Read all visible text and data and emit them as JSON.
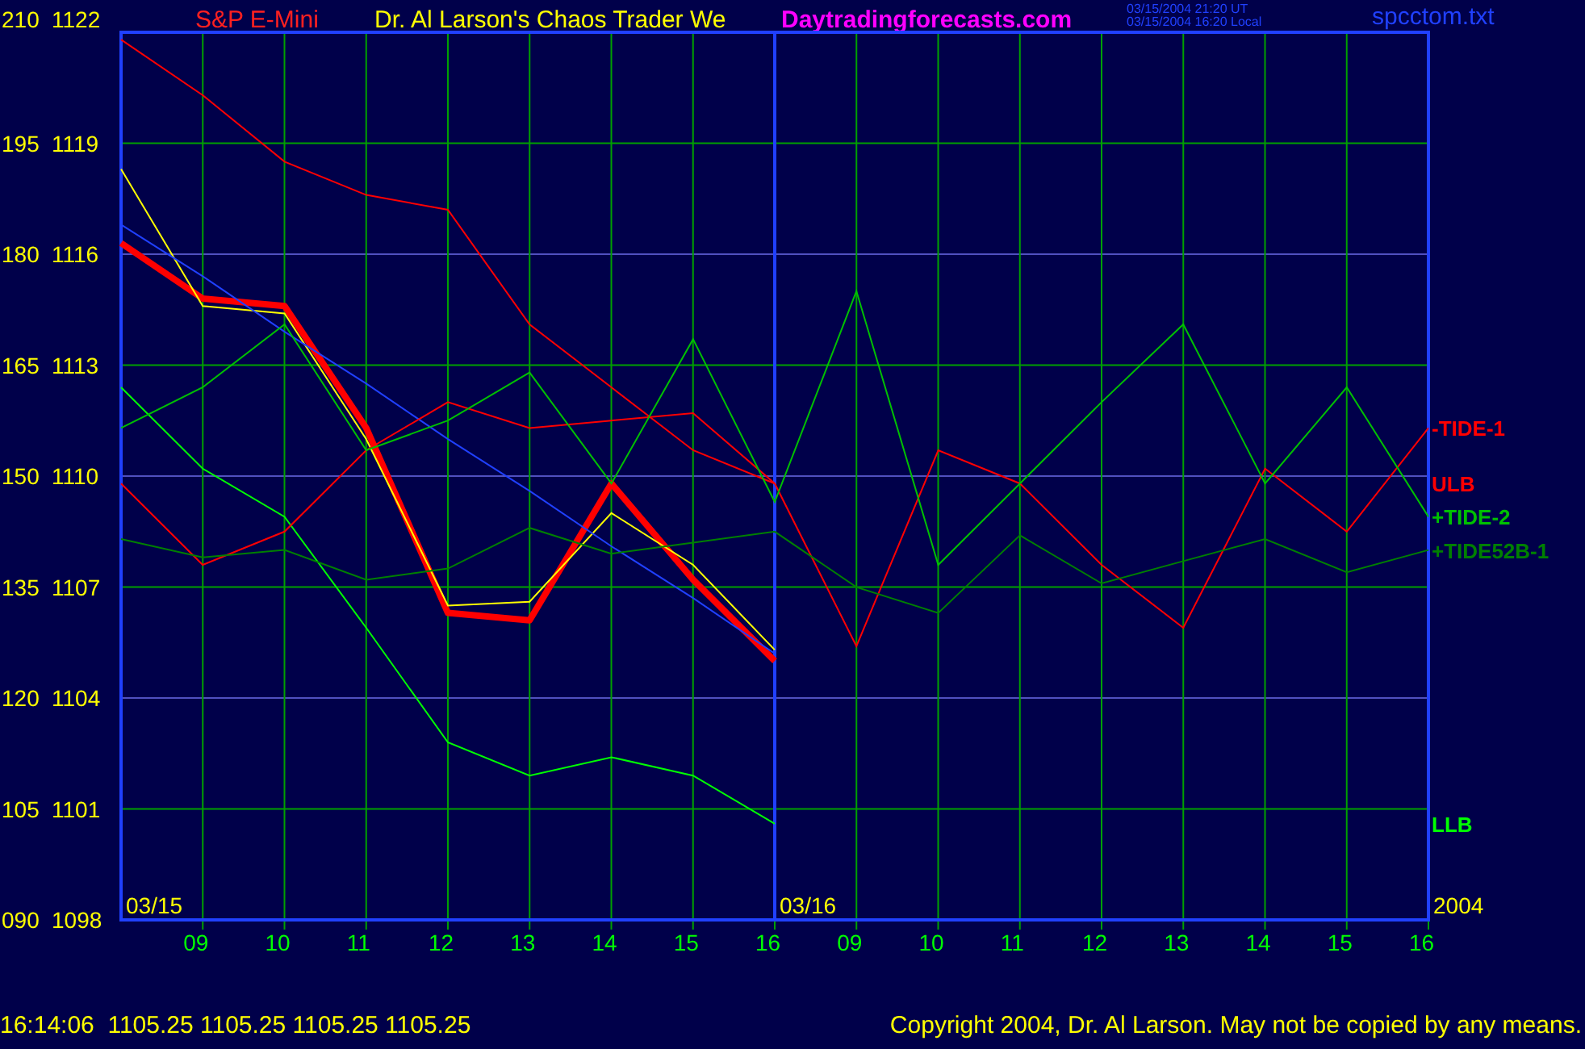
{
  "header": {
    "instrument": "S&P E-Mini",
    "title": "Dr. Al Larson's Chaos Trader We",
    "site": "Daytradingforecasts.com",
    "timestamps": [
      "03/15/2004 21:20 UT",
      "03/15/2004 16:20 Local"
    ],
    "file": "spcctom.txt"
  },
  "chart": {
    "chart_data": {
      "type": "line",
      "categories": [
        null,
        "09",
        "10",
        "11",
        "12",
        "13",
        "14",
        "15",
        "16",
        "09",
        "10",
        "11",
        "12",
        "13",
        "14",
        "15",
        "16"
      ],
      "ylim": [
        1098,
        1122
      ],
      "grid": true,
      "yticks": [
        1122,
        1119,
        1116,
        1113,
        1110,
        1107,
        1104,
        1101,
        1098
      ],
      "series": [
        {
          "color": "#ff0000",
          "values": [
            1116.3,
            1114.8,
            1114.6,
            1111.3,
            1106.3,
            1106.1,
            1109.8,
            1107.2,
            1105.0,
            null,
            null,
            null,
            null,
            null,
            null,
            null,
            null
          ]
        },
        {
          "color": "#ffff00",
          "values": [
            1118.3,
            1114.6,
            1114.4,
            1111.0,
            1106.5,
            1106.6,
            1109.0,
            1107.6,
            1105.3,
            null,
            null,
            null,
            null,
            null,
            null,
            null,
            null
          ]
        },
        {
          "color": "#2040ff",
          "values": [
            1116.8,
            1115.4,
            1113.9,
            1112.5,
            1111.0,
            1109.6,
            1108.1,
            1106.7,
            1105.2,
            null,
            null,
            null,
            null,
            null,
            null,
            null,
            null
          ]
        },
        {
          "name": "ULB",
          "color": "#ff0000",
          "values": [
            1121.8,
            1120.3,
            1118.5,
            1117.6,
            1117.2,
            1114.1,
            1112.4,
            1110.7,
            1109.8,
            null,
            null,
            null,
            null,
            null,
            null,
            null,
            null
          ]
        },
        {
          "name": "LLB",
          "color": "#00ff00",
          "values": [
            1112.4,
            1110.2,
            1108.9,
            1105.9,
            1102.8,
            1101.9,
            1102.4,
            1101.9,
            1100.6,
            null,
            null,
            null,
            null,
            null,
            null,
            null,
            null
          ]
        },
        {
          "name": "-TIDE-1",
          "color": "#ff0000",
          "values": [
            1109.8,
            1107.6,
            1108.5,
            1110.7,
            1112.0,
            1111.3,
            1111.5,
            1111.7,
            1109.8,
            1105.4,
            1110.7,
            1109.8,
            1107.6,
            1105.9,
            1110.2,
            1108.5,
            1111.3
          ]
        },
        {
          "name": "+TIDE-2",
          "color": "#00c000",
          "values": [
            1111.3,
            1112.4,
            1114.1,
            1110.7,
            1111.5,
            1112.8,
            1109.8,
            1113.7,
            1109.3,
            1115.0,
            1107.6,
            1109.8,
            1112.0,
            1114.1,
            1109.8,
            1112.4,
            1108.9
          ]
        },
        {
          "name": "+TIDE52B-1",
          "color": "#008000",
          "values": [
            1108.3,
            1107.8,
            1108.0,
            1107.2,
            1107.5,
            1108.6,
            1107.9,
            1108.2,
            1108.5,
            1107.0,
            1106.3,
            1108.4,
            1107.1,
            1107.7,
            1108.3,
            1107.4,
            1108.0
          ]
        }
      ]
    },
    "axis_codes": [
      "210",
      "195",
      "180",
      "165",
      "150",
      "135",
      "120",
      "105",
      "090"
    ],
    "date_labels": [
      {
        "text": "03/15"
      },
      {
        "text": "03/16"
      },
      {
        "text": "2004"
      }
    ]
  },
  "status_bar": {
    "quote": "16:14:06  1105.25 1105.25 1105.25 1105.25",
    "copyright": "Copyright 2004, Dr. Al Larson. May not be copied by any means."
  }
}
